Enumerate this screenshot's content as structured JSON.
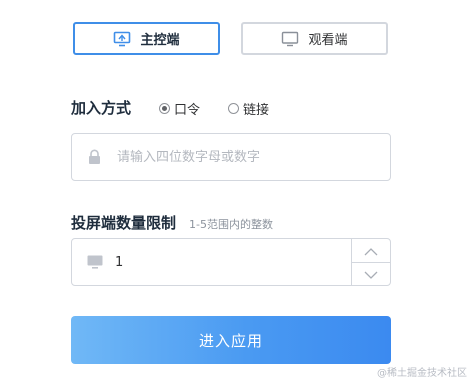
{
  "roles": {
    "host_label": "主控端",
    "viewer_label": "观看端",
    "host_icon": "screen-cast-icon",
    "viewer_icon": "monitor-icon"
  },
  "join": {
    "label": "加入方式",
    "options": [
      "口令",
      "链接"
    ],
    "selected": "口令"
  },
  "password": {
    "placeholder": "请输入四位数字母或数字",
    "value": ""
  },
  "limit": {
    "label": "投屏端数量限制",
    "hint": "1-5范围内的整数",
    "value": "1"
  },
  "submit_label": "进入应用",
  "watermark": "@稀土掘金技术社区",
  "colors": {
    "accent": "#3f8ee8",
    "button_gradient_start": "#70b8f6",
    "button_gradient_end": "#3b8af0"
  }
}
